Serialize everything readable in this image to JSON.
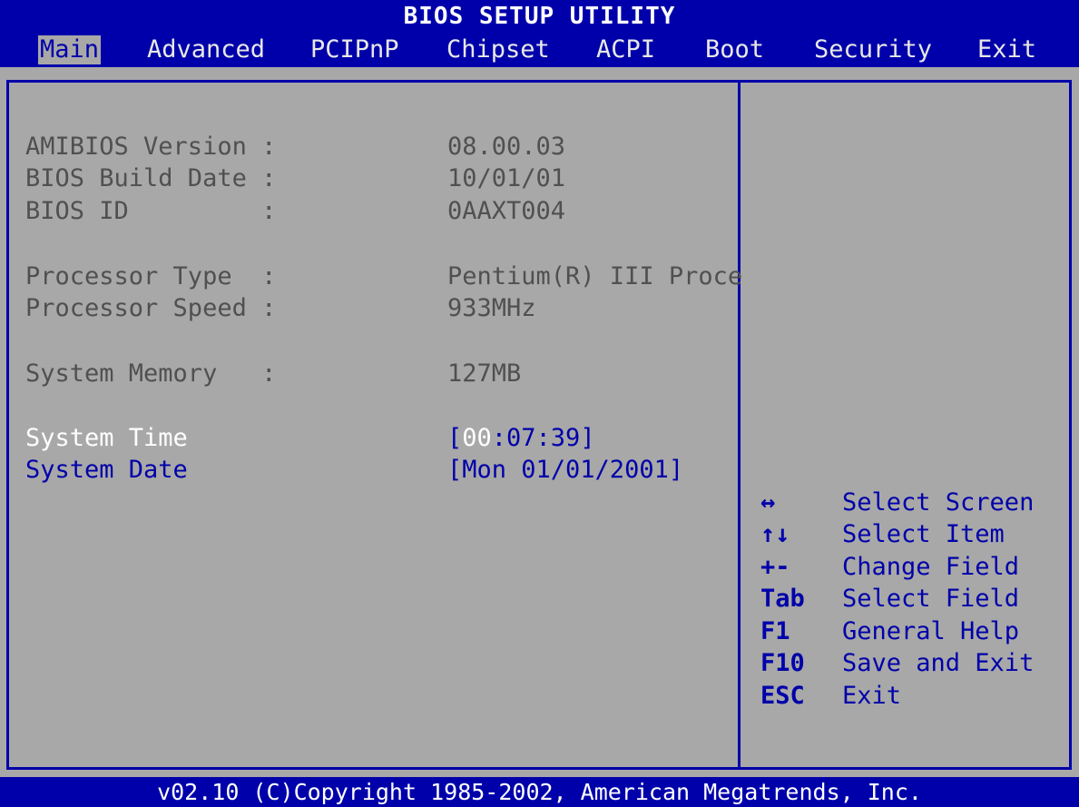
{
  "title": "BIOS SETUP UTILITY",
  "menu": [
    {
      "label": "Main",
      "active": true
    },
    {
      "label": "Advanced"
    },
    {
      "label": "PCIPnP"
    },
    {
      "label": "Chipset"
    },
    {
      "label": "ACPI"
    },
    {
      "label": "Boot"
    },
    {
      "label": "Security"
    },
    {
      "label": "Exit"
    }
  ],
  "info": [
    {
      "label": "AMIBIOS Version :",
      "value": "08.00.03"
    },
    {
      "label": "BIOS Build Date :",
      "value": "10/01/01"
    },
    {
      "label": "BIOS ID         :",
      "value": "0AAXT004"
    },
    {
      "label": "Processor Type  :",
      "value": "Pentium(R) III Proce"
    },
    {
      "label": "Processor Speed :",
      "value": "933MHz"
    },
    {
      "label": "System Memory   :",
      "value": "127MB"
    }
  ],
  "settings": {
    "time_label": "System Time",
    "time_open": "[",
    "time_hl": "00",
    "time_rest": ":07:39]",
    "date_label": "System Date",
    "date_value": "[Mon 01/01/2001]"
  },
  "help": [
    {
      "key": "↔",
      "text": "Select Screen"
    },
    {
      "key": "↑↓",
      "text": "Select Item"
    },
    {
      "key": "+-",
      "text": "Change Field"
    },
    {
      "key": "Tab",
      "text": "Select Field"
    },
    {
      "key": "F1",
      "text": "General Help"
    },
    {
      "key": "F10",
      "text": "Save and Exit"
    },
    {
      "key": "ESC",
      "text": "Exit"
    }
  ],
  "footer": "v02.10 (C)Copyright 1985-2002, American Megatrends, Inc.",
  "colors": {
    "blue": "#0000aa",
    "gray": "#a8a8a8",
    "dim_text": "#505050",
    "white": "#ffffff"
  }
}
